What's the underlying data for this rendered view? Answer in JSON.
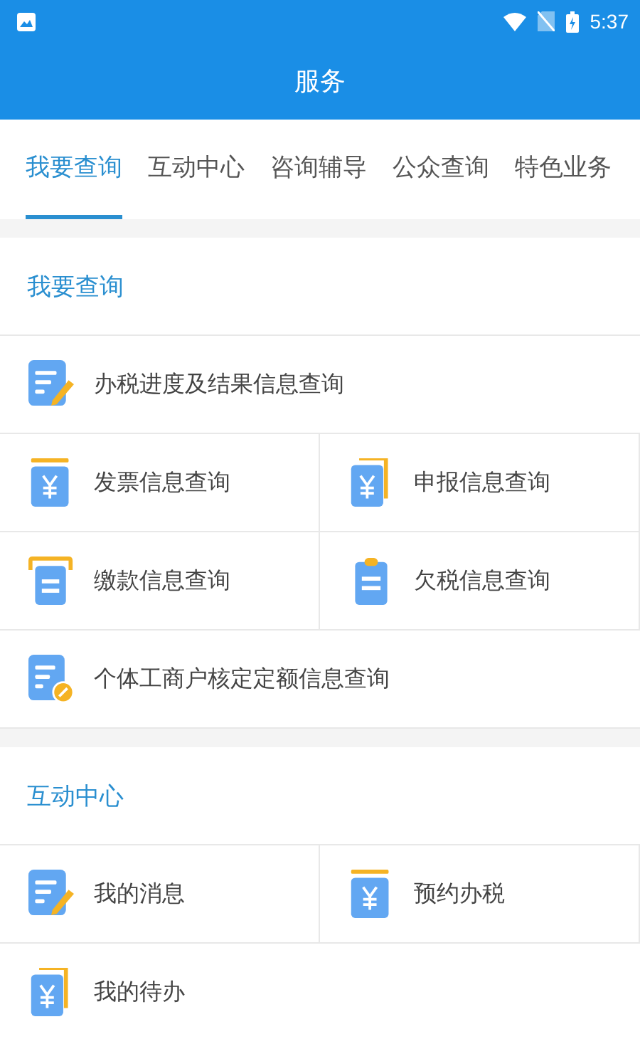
{
  "status_bar": {
    "time": "5:37"
  },
  "header": {
    "title": "服务"
  },
  "tabs": [
    {
      "label": "我要查询",
      "selected": true
    },
    {
      "label": "互动中心",
      "selected": false
    },
    {
      "label": "咨询辅导",
      "selected": false
    },
    {
      "label": "公众查询",
      "selected": false
    },
    {
      "label": "特色业务",
      "selected": false
    }
  ],
  "sections": [
    {
      "title": "我要查询",
      "items": [
        {
          "label": "办税进度及结果信息查询",
          "kind": "edit",
          "wide": true
        },
        {
          "label": "发票信息查询",
          "kind": "yen-bar",
          "wide": false
        },
        {
          "label": "申报信息查询",
          "kind": "yen-stack",
          "wide": false
        },
        {
          "label": "缴款信息查询",
          "kind": "list-frame",
          "wide": false
        },
        {
          "label": "欠税信息查询",
          "kind": "clipboard",
          "wide": false
        },
        {
          "label": "个体工商户核定定额信息查询",
          "kind": "doc-check",
          "wide": true
        }
      ]
    },
    {
      "title": "互动中心",
      "items": [
        {
          "label": "我的消息",
          "kind": "edit",
          "wide": false
        },
        {
          "label": "预约办税",
          "kind": "yen-bar",
          "wide": false
        },
        {
          "label": "我的待办",
          "kind": "yen-stack",
          "wide": false
        }
      ]
    }
  ]
}
